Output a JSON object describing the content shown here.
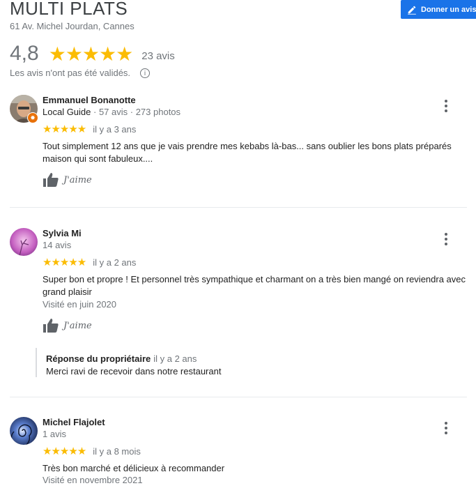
{
  "place": {
    "name": "MULTI PLATS",
    "address": "61 Av. Michel Jourdan, Cannes",
    "rating": "4,8",
    "review_count": "23 avis",
    "unverified_note": "Les avis n'ont pas été validés."
  },
  "actions": {
    "write_review": "Donner un avis"
  },
  "colors": {
    "star": "#fbbc04",
    "accent": "#1a73e8",
    "guide_badge": "#e8710a"
  },
  "reviews": [
    {
      "author": "Emmanuel Bonanotte",
      "meta_guide": "Local Guide",
      "meta_rest": "· 57 avis · 273 photos",
      "stars": 5,
      "time": "il y a 3 ans",
      "text": "Tout simplement 12 ans que je vais prendre mes kebabs là-bas... sans oublier les bons plats préparés maison qui sont fabuleux....",
      "like_label": "J'aime"
    },
    {
      "author": "Sylvia Mi",
      "meta": "14 avis",
      "stars": 5,
      "time": "il y a 2 ans",
      "text": "Super bon et propre ! Et personnel très sympathique et charmant on a très bien mangé on reviendra avec grand plaisir",
      "visited": "Visité en juin 2020",
      "like_label": "J'aime",
      "owner_reply": {
        "label": "Réponse du propriétaire",
        "time": "il y a 2 ans",
        "text": "Merci ravi de recevoir dans notre restaurant"
      }
    },
    {
      "author": "Michel Flajolet",
      "meta": "1 avis",
      "stars": 5,
      "time": "il y a 8 mois",
      "text": "Très bon marché et délicieux à recommander",
      "visited": "Visité en novembre 2021"
    }
  ],
  "icons": {
    "write": "pencil-icon",
    "info": "info-icon",
    "more": "more-vert-icon",
    "like": "thumbs-up-icon",
    "star": "star-icon"
  }
}
